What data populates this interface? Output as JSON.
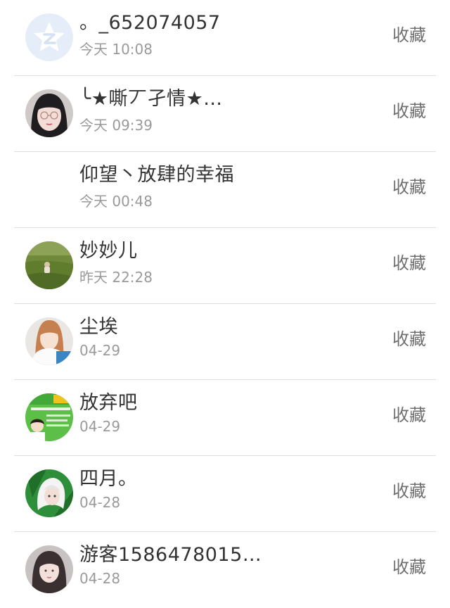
{
  "contacts": [
    {
      "name": "。_652074057",
      "time": "今天 10:08",
      "action": "收藏",
      "avatar": "qzone-star-icon"
    },
    {
      "name": "╰★嘶丆孑情★…",
      "time": "今天 09:39",
      "action": "收藏",
      "avatar": "girl-glasses-photo"
    },
    {
      "name": "仰望丶放肆的幸福",
      "time": "今天 00:48",
      "action": "收藏",
      "avatar": ""
    },
    {
      "name": "妙妙儿",
      "time": "昨天 22:28",
      "action": "收藏",
      "avatar": "grass-field-photo"
    },
    {
      "name": "尘埃",
      "time": "04-29",
      "action": "收藏",
      "avatar": "girl-white-shirt-photo"
    },
    {
      "name": "放弃吧",
      "time": "04-29",
      "action": "收藏",
      "avatar": "green-poster-photo"
    },
    {
      "name": "四月。",
      "time": "04-28",
      "action": "收藏",
      "avatar": "anime-green-photo"
    },
    {
      "name": "游客1586478015…",
      "time": "04-28",
      "action": "收藏",
      "avatar": "girl-portrait-photo"
    }
  ]
}
